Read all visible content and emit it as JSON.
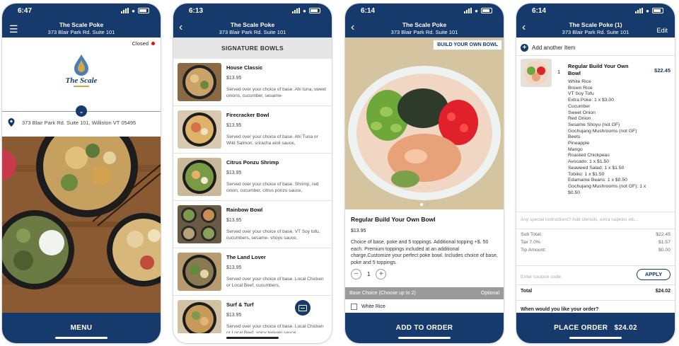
{
  "colors": {
    "brand": "#153a6b",
    "closed_dot": "#dd1111",
    "price_accent": "#153a6b"
  },
  "screen1": {
    "time": "6:47",
    "title": "The Scale Poke",
    "subtitle": "373 Blair Park Rd. Suite 101",
    "menu_icon": "hamburger-icon",
    "status": "Closed",
    "logo_text": "The Scale",
    "address": "373 Blair Park Rd. Suite 101, Williston VT  05495",
    "bottom_button": "MENU"
  },
  "screen2": {
    "time": "6:13",
    "title": "The Scale Poke",
    "subtitle": "373 Blair Park Rd. Suite 101",
    "back_icon": "back-chevron-icon",
    "section": "SIGNATURE BOWLS",
    "items": [
      {
        "name": "House Classic",
        "price": "$13.95",
        "desc": "Served over your choice of base. Ahi tuna, sweet onions, cucumber, sesame-"
      },
      {
        "name": "Firecracker Bowl",
        "price": "$13.95",
        "desc": "Served over your choice of base. Ahi Tuna or Wild Salmon, sriracha aioli sauce,"
      },
      {
        "name": "Citrus Ponzu Shrimp",
        "price": "$13.95",
        "desc": "Served over your choice of base. Shrimp, red onion, cucumber, citrus ponzu sauce,"
      },
      {
        "name": "Rainbow Bowl",
        "price": "$13.95",
        "desc": "Served over your choice of base. VT Soy tofu, cucumbers, sesame- shoyu sauce,"
      },
      {
        "name": "The Land Lover",
        "price": "$13.95",
        "desc": "Served over your choice of base. Local Chicken or Local Beef, cucumbers,"
      },
      {
        "name": "Surf & Turf",
        "price": "$13.95",
        "desc": "Served over your choice of base. Local Chicken or Local Beef, spicy teriyaki sauce,"
      }
    ]
  },
  "screen3": {
    "time": "6:14",
    "title": "The Scale Poke",
    "subtitle": "373 Blair Park Rd. Suite 101",
    "tag": "BUILD YOUR OWN BOWL",
    "product_name": "Regular Build Your Own Bowl",
    "price": "$13.95",
    "description": "Choice of base, poke and 5 toppings. Additional topping +$. 50 each. Premium toppings included at an additional charge.Customize your perfect poke bowl. Includes choice of base, poke and 5 toppings.",
    "quantity": "1",
    "choice_label": "Base Choice (Choose up to 2)",
    "choice_optional": "Optional",
    "choice_option": "White Rice",
    "bottom_button": "ADD TO ORDER"
  },
  "screen4": {
    "time": "6:14",
    "title": "The Scale Poke (1)",
    "subtitle": "373 Blair Park Rd. Suite 101",
    "edit_label": "Edit",
    "add_another": "Add another Item",
    "item_qty": "1",
    "item_name": "Regular Build Your Own Bowl",
    "item_price": "$22.45",
    "modifiers": [
      "White Rice",
      "Brown Rice",
      "VT Soy Tofu",
      "Extra Poke: 1 x $3.00",
      "Cucumber",
      "Sweet Onion",
      "Red Onion",
      "Sesame Shoyu (not GF)",
      "Gochujang Mushrooms (not GF)",
      "Beets",
      "Pineapple",
      "Mango",
      "Roasted Chickpeas",
      "Avocado: 1 x $1.50",
      "Seaweed Salad: 1 x $1.50",
      "Tobiko: 1 x $1.50",
      "Edamame Beans: 1 x $0.50",
      "Gochujang Mushrooms (not GF): 1 x $0.50"
    ],
    "instructions_placeholder": "Any special instructions? Add utensils, extra napkins etc...",
    "subtotal_label": "Sub Total:",
    "subtotal": "$22.45",
    "tax_label": "Tax 7.0%",
    "tax": "$1.57",
    "tip_label": "Tip Amount:",
    "tip": "$0.00",
    "coupon_placeholder": "Enter coupon code",
    "apply_label": "APPLY",
    "total_label": "Total",
    "total": "$24.02",
    "when_label": "When would you like your order?",
    "bottom_button": "PLACE ORDER   $24.02"
  }
}
